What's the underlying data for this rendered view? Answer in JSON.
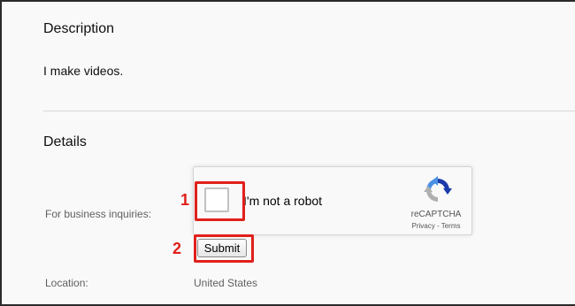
{
  "description": {
    "title": "Description",
    "text": "I make videos."
  },
  "details": {
    "title": "Details",
    "business_inquiries_label": "For business inquiries:",
    "location_label": "Location:",
    "location_value": "United States"
  },
  "recaptcha": {
    "checkbox_label": "I'm not a robot",
    "brand": "reCAPTCHA",
    "privacy_link": "Privacy",
    "separator": " - ",
    "terms_link": "Terms",
    "logo_icon": "recaptcha-logo-icon"
  },
  "submit_label": "Submit",
  "annotations": {
    "step1": "1",
    "step2": "2",
    "color": "#e0201b"
  },
  "colors": {
    "panel_background": "#f9f9f9",
    "frame": "#2b2b2b",
    "recaptcha_blue": "#1c3aa9",
    "recaptcha_light_blue": "#4a90e2",
    "recaptcha_gray": "#b0b0b0"
  }
}
